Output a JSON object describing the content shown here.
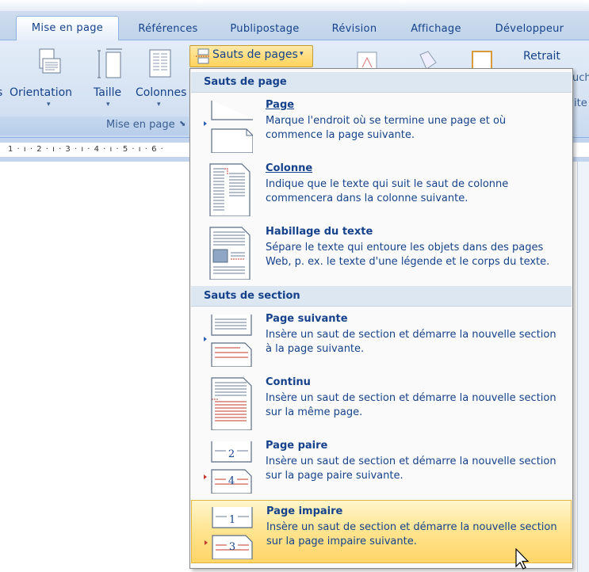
{
  "tabs": [
    {
      "label": "Mise en page",
      "active": true
    },
    {
      "label": "Références"
    },
    {
      "label": "Publipostage"
    },
    {
      "label": "Révision"
    },
    {
      "label": "Affichage"
    },
    {
      "label": "Développeur"
    }
  ],
  "ribbon": {
    "orientation_label": "Orientation",
    "orientation_prefix": "s",
    "taille_label": "Taille",
    "colonnes_label": "Colonnes",
    "sauts_button_label": "Sauts de pages",
    "group_label": "Mise en page",
    "retrait_label": "Retrait",
    "right_clip_1": "uch",
    "right_clip_2": "ite"
  },
  "ruler": {
    "text": "1 · ı · 2 · ı · 3 · ı · 4 · ı · 5 · ı · 6 ·"
  },
  "menu": {
    "header_page": "Sauts de page",
    "header_section": "Sauts de section",
    "items": [
      {
        "title": "Page",
        "desc": "Marque l'endroit où se termine une page et où commence la page suivante.",
        "icon": "page-break-icon"
      },
      {
        "title": "Colonne",
        "desc": "Indique que le texte qui suit le saut de colonne commencera dans la colonne suivante.",
        "icon": "column-break-icon"
      },
      {
        "title": "Habillage du texte",
        "desc": "Sépare le texte qui entoure les objets dans des pages Web, p. ex. le texte d'une légende et le corps du texte.",
        "icon": "text-wrap-break-icon"
      },
      {
        "title": "Page suivante",
        "desc": "Insère un saut de section et démarre la nouvelle section à la page suivante.",
        "icon": "next-page-section-icon"
      },
      {
        "title": "Continu",
        "desc": "Insère un saut de section et démarre la nouvelle section sur la même page.",
        "icon": "continuous-section-icon"
      },
      {
        "title": "Page paire",
        "desc": "Insère un saut de section et démarre la nouvelle section sur la page paire suivante.",
        "icon": "even-page-section-icon"
      },
      {
        "title": "Page impaire",
        "desc": "Insère un saut de section et démarre la nouvelle section sur la page impaire suivante.",
        "icon": "odd-page-section-icon",
        "highlighted": true
      }
    ],
    "even_icon_top_number": "2",
    "even_icon_bottom_number": "4",
    "odd_icon_top_number": "1",
    "odd_icon_bottom_number": "3"
  },
  "colors": {
    "accent": "#15428b",
    "highlight": "#ffd568",
    "header_bg": "#dde7f2"
  }
}
